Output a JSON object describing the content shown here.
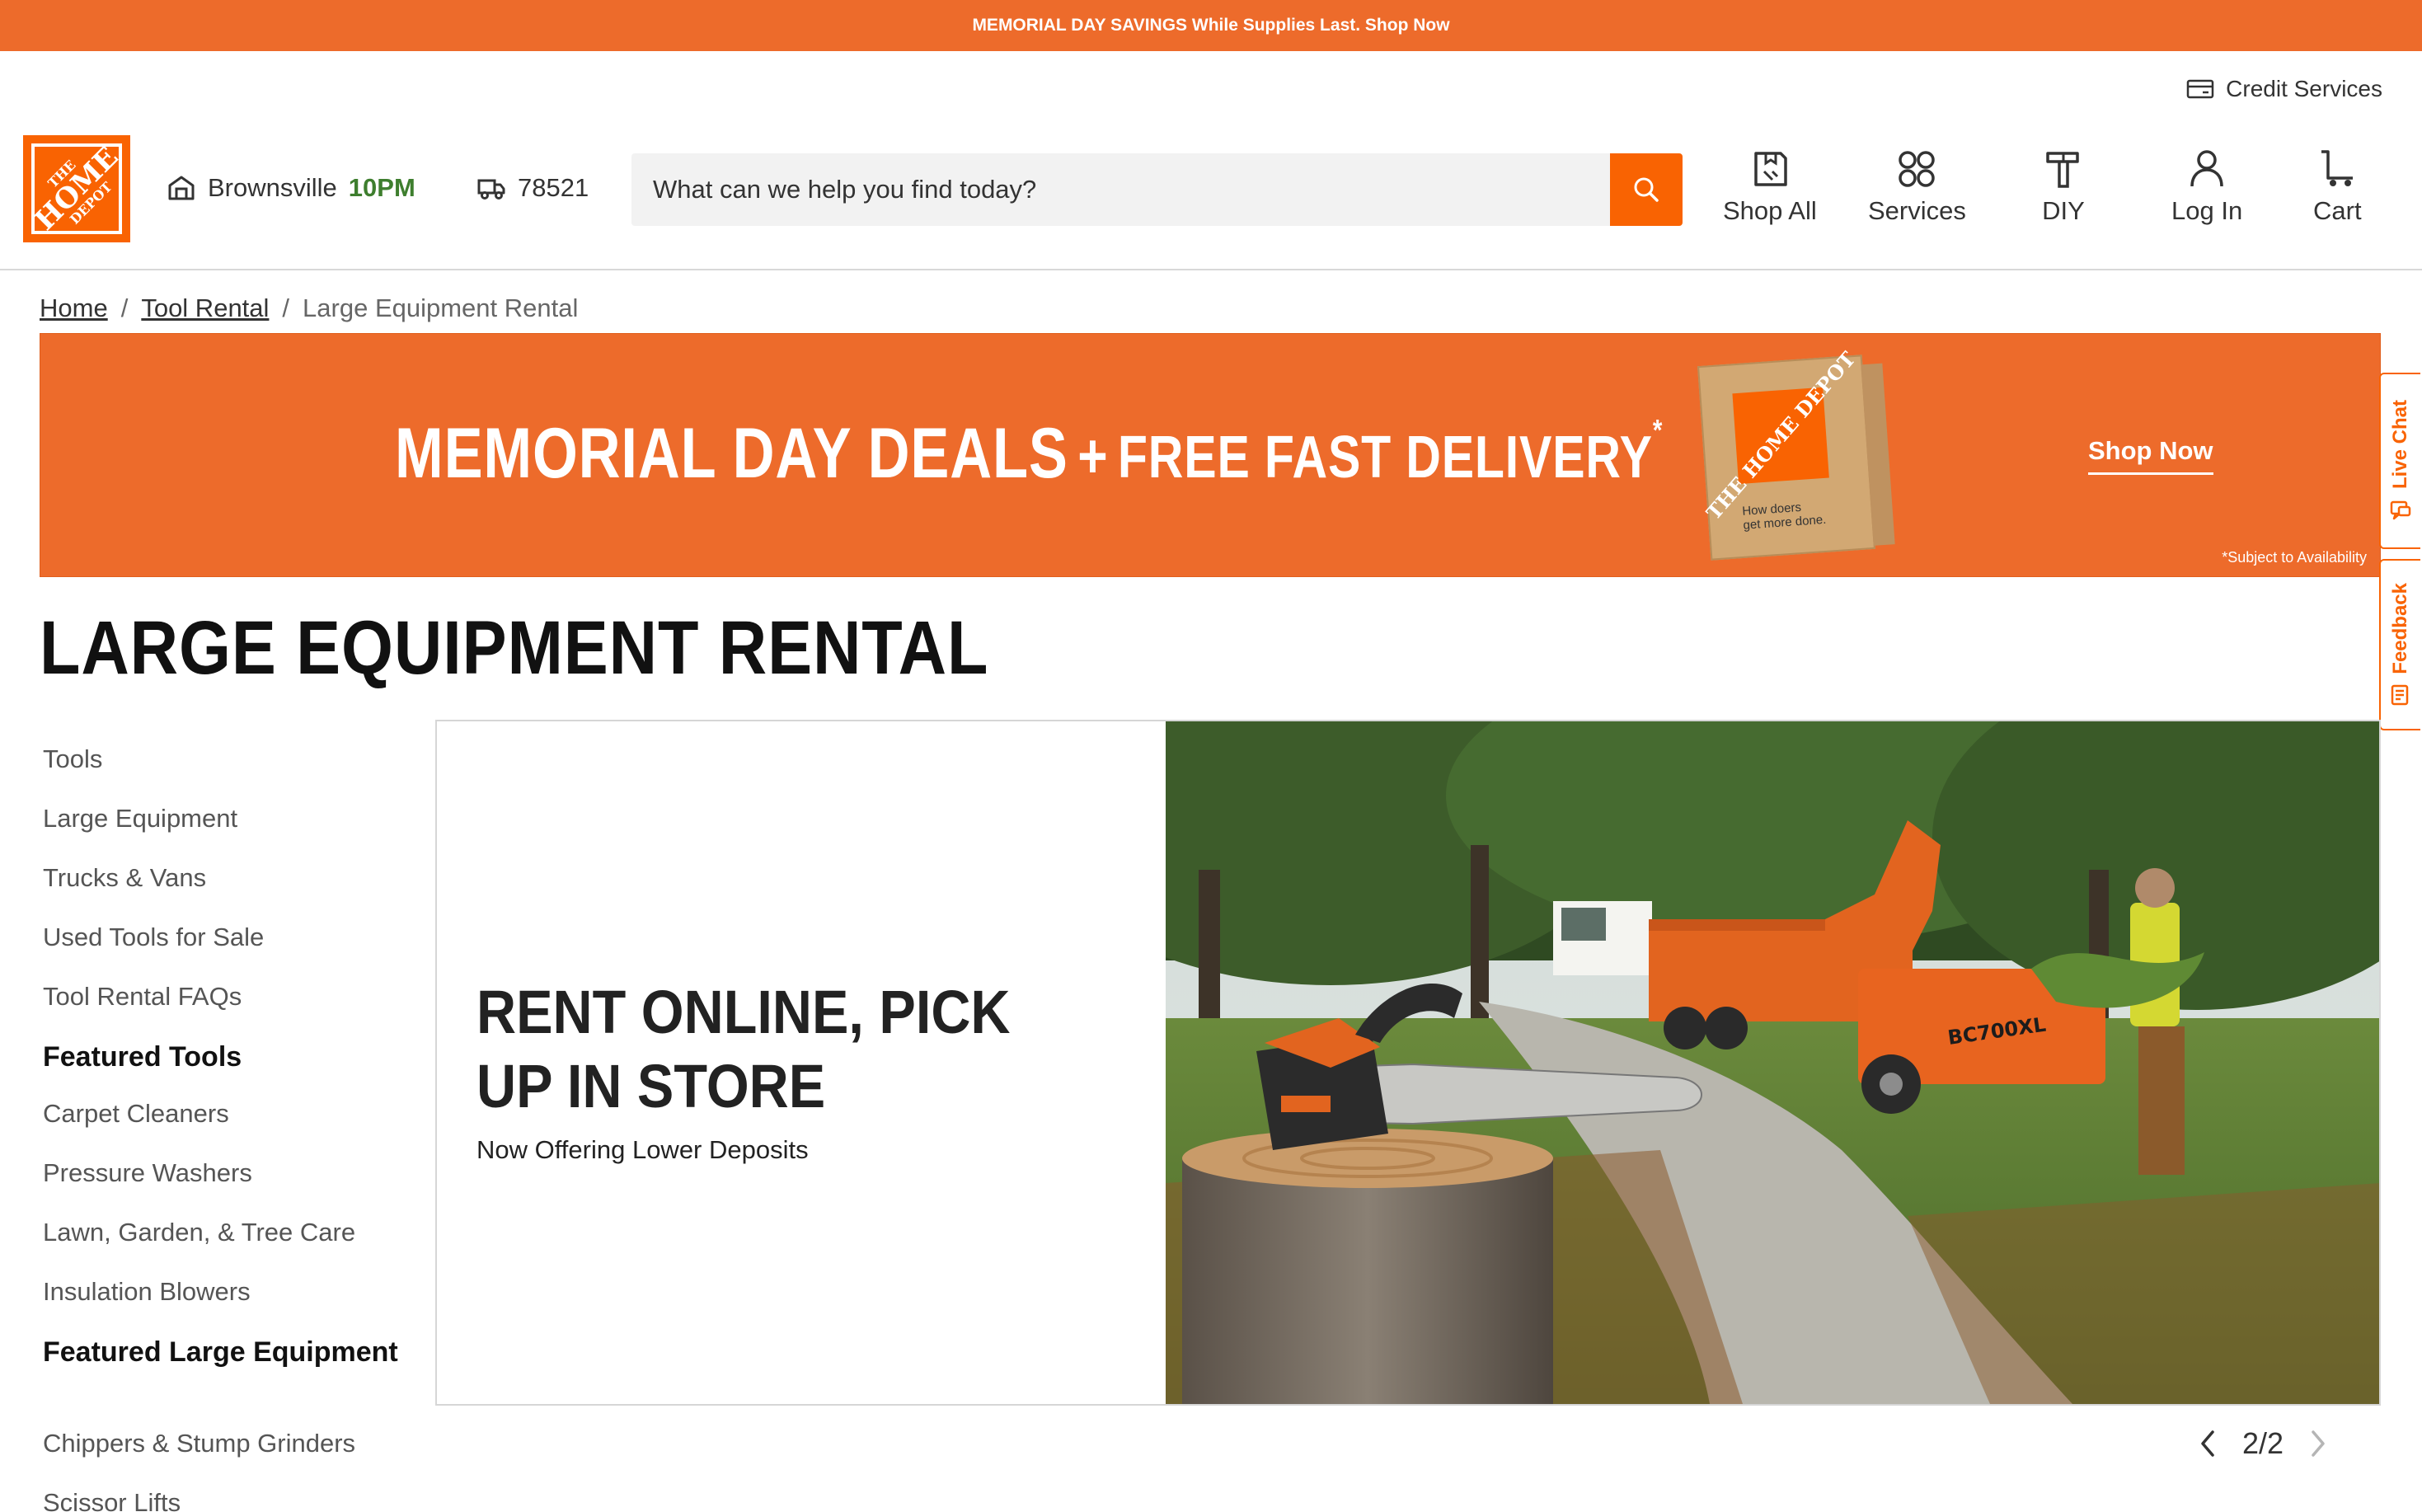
{
  "promo": {
    "text": "MEMORIAL DAY SAVINGS While Supplies Last. Shop Now"
  },
  "header": {
    "credit_services": "Credit Services",
    "logo": {
      "line1": "THE",
      "line2": "HOME",
      "line3": "DEPOT"
    },
    "store": {
      "name": "Brownsville",
      "hours": "10PM"
    },
    "zip": "78521",
    "search": {
      "placeholder": "What can we help you find today?"
    },
    "nav": [
      {
        "label": "Shop All",
        "icon": "shop-all-icon"
      },
      {
        "label": "Services",
        "icon": "services-icon"
      },
      {
        "label": "DIY",
        "icon": "diy-hammer-icon"
      },
      {
        "label": "Log In",
        "icon": "user-icon"
      },
      {
        "label": "Cart",
        "icon": "cart-icon"
      }
    ]
  },
  "breadcrumb": {
    "home": "Home",
    "tool_rental": "Tool Rental",
    "current": "Large Equipment Rental",
    "sep": "/"
  },
  "banner": {
    "title": "MEMORIAL DAY DEALS",
    "plus": "+",
    "subtitle": "FREE FAST DELIVERY",
    "asterisk": "*",
    "box_logo": "THE HOME DEPOT",
    "box_tag_line1": "How doers",
    "box_tag_line2": "get more done.",
    "cta": "Shop Now",
    "note": "*Subject to Availability"
  },
  "side_tabs": {
    "live_chat": "Live Chat",
    "feedback": "Feedback"
  },
  "page_title": "LARGE EQUIPMENT RENTAL",
  "sidenav": {
    "links": [
      "Tools",
      "Large Equipment",
      "Trucks & Vans",
      "Used Tools for Sale",
      "Tool Rental FAQs"
    ],
    "featured_tools_heading": "Featured Tools",
    "featured_tools": [
      "Carpet Cleaners",
      "Pressure Washers",
      "Lawn, Garden, & Tree Care",
      "Insulation Blowers"
    ],
    "featured_large_heading": "Featured Large Equipment",
    "featured_large": [
      "Chippers & Stump Grinders",
      "Scissor Lifts"
    ]
  },
  "hero": {
    "title": "RENT ONLINE, PICK UP IN STORE",
    "subtitle": "Now Offering Lower Deposits",
    "chipper_label": "BC700XL"
  },
  "carousel": {
    "position": "2/2"
  },
  "colors": {
    "brand_orange": "#f96302",
    "banner_orange": "#ed6b2b",
    "store_hours_green": "#3e7e2e"
  }
}
